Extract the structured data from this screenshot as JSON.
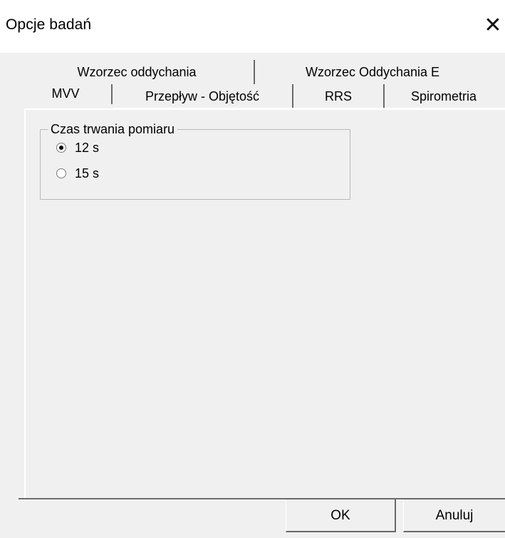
{
  "window": {
    "title": "Opcje badań",
    "close_symbol": "✕"
  },
  "tabs": {
    "back_row": [
      {
        "label": "Wzorzec oddychania"
      },
      {
        "label": "Wzorzec Oddychania E"
      }
    ],
    "front_row": [
      {
        "label": "MVV",
        "selected": true
      },
      {
        "label": "Przepływ - Objętość"
      },
      {
        "label": "RRS"
      },
      {
        "label": "Spirometria"
      }
    ]
  },
  "measurement_group": {
    "label": "Czas trwania pomiaru",
    "options": [
      {
        "label": "12 s",
        "checked": true
      },
      {
        "label": "15 s",
        "checked": false
      }
    ]
  },
  "buttons": {
    "ok": "OK",
    "cancel": "Anuluj"
  }
}
